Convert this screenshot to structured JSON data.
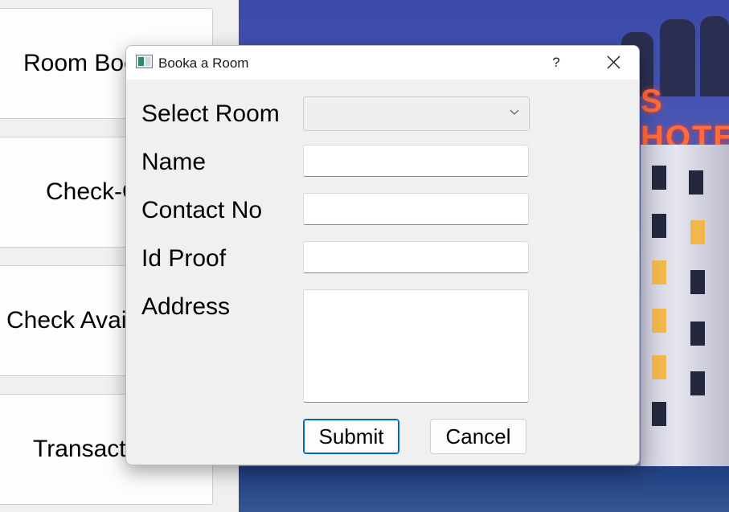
{
  "nav": {
    "items": [
      {
        "label": "Room Booking"
      },
      {
        "label": "Check-Out"
      },
      {
        "label": "Check Availability"
      },
      {
        "label": "Transactions"
      }
    ]
  },
  "background": {
    "sign_text": "S HOTE"
  },
  "dialog": {
    "title": "Booka a Room",
    "help_label": "?",
    "fields": {
      "select_room_label": "Select Room",
      "select_room_value": "",
      "name_label": "Name",
      "name_value": "",
      "contact_label": "Contact No",
      "contact_value": "",
      "id_proof_label": "Id Proof",
      "id_proof_value": "",
      "address_label": "Address",
      "address_value": ""
    },
    "submit_label": "Submit",
    "cancel_label": "Cancel"
  },
  "colors": {
    "accent": "#0067c0",
    "dialog_bg": "#f0f0f0",
    "titlebar_bg": "#ffffff"
  },
  "icons": {
    "app": "app-window-icon",
    "help": "help-icon",
    "close": "close-icon",
    "dropdown": "chevron-down-icon"
  }
}
